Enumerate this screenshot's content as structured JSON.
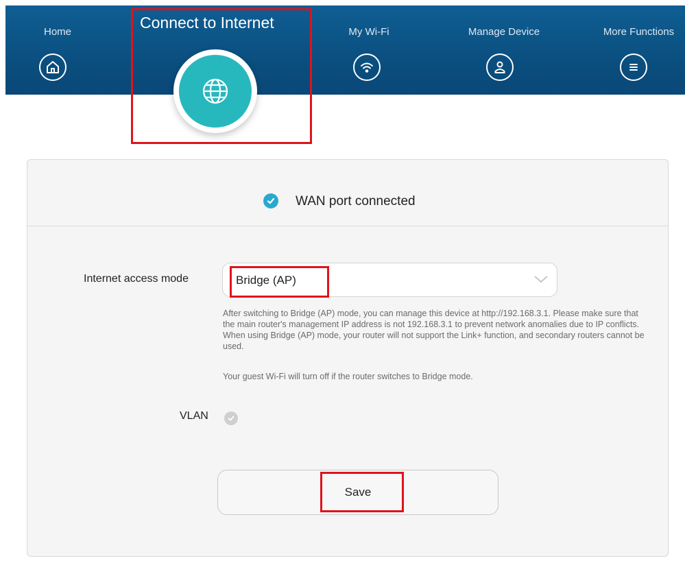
{
  "nav": {
    "home": {
      "label": "Home",
      "icon": "home-icon"
    },
    "connect": {
      "label": "Connect to Internet",
      "icon": "globe-icon"
    },
    "wifi": {
      "label": "My Wi-Fi",
      "icon": "wifi-icon"
    },
    "device": {
      "label": "Manage Device",
      "icon": "user-icon"
    },
    "more": {
      "label": "More Functions",
      "icon": "menu-icon"
    }
  },
  "status": {
    "text": "WAN port connected",
    "icon": "check-circle-icon"
  },
  "form": {
    "access_mode_label": "Internet access mode",
    "access_mode_value": "Bridge (AP)",
    "help_1": "After switching to Bridge (AP) mode, you can manage this device at http://192.168.3.1. Please make sure that the main router's management IP address is not 192.168.3.1 to prevent network anomalies due to IP conflicts. When using Bridge (AP) mode, your router will not support the Link+ function, and secondary routers cannot be used.",
    "help_2": "Your guest Wi-Fi will turn off if the router switches to Bridge mode.",
    "vlan_label": "VLAN",
    "save_label": "Save"
  },
  "colors": {
    "header": "#0f5e93",
    "accent": "#27b8bd",
    "check": "#2aa9cf",
    "highlight": "#e0131a"
  }
}
